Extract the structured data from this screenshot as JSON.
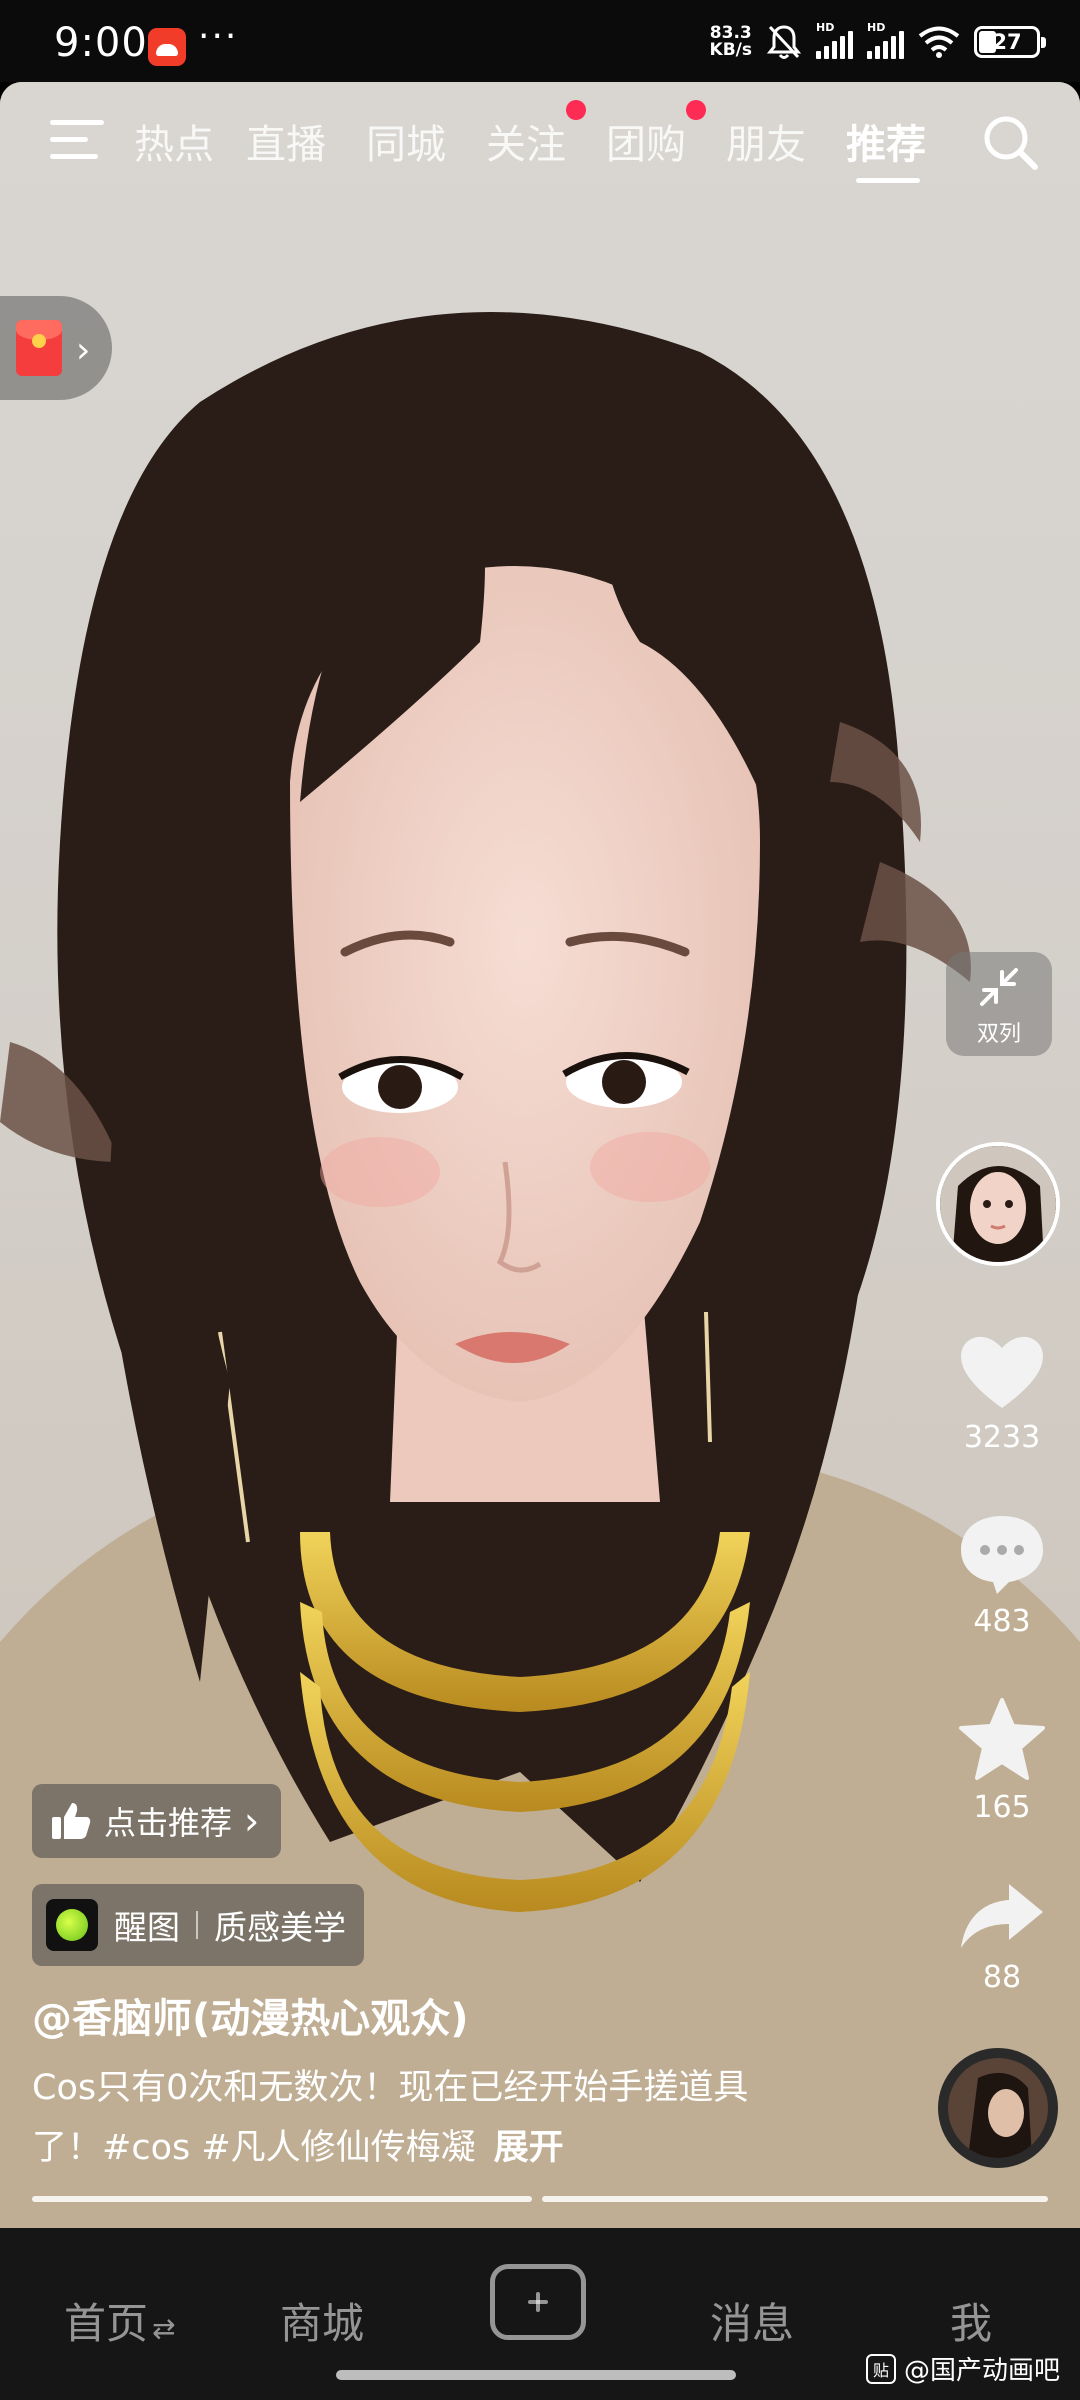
{
  "status_bar": {
    "time": "9:00",
    "dots": "···",
    "net_speed_value": "83.3",
    "net_speed_unit": "KB/s",
    "signal_label": "HD",
    "battery": "27"
  },
  "top_tabs": {
    "items": [
      "热点",
      "直播",
      "同城",
      "关注",
      "团购",
      "朋友",
      "推荐"
    ],
    "active": "推荐"
  },
  "side": {
    "dual_column_label": "双列",
    "likes": "3233",
    "comments": "483",
    "favorites": "165",
    "shares": "88"
  },
  "overlay": {
    "recommend_label": "点击推荐",
    "effect_name": "醒图",
    "effect_tag": "质感美学",
    "author": "@香脑师(动漫热心观众)",
    "caption_line1": "Cos只有0次和无数次！现在已经开始手搓道具",
    "caption_line2": "了！#cos #凡人修仙传梅凝",
    "expand": "展开"
  },
  "bottom_nav": {
    "items": [
      "首页",
      "商城",
      "消息",
      "我"
    ],
    "active": "首页"
  },
  "watermark": {
    "logo_text": "贴",
    "text": "@国产动画吧"
  },
  "colors": {
    "accent_dot": "#fe2c55",
    "bottom_nav_bg": "#161616",
    "status_bar_bg": "#0b0b0b"
  }
}
